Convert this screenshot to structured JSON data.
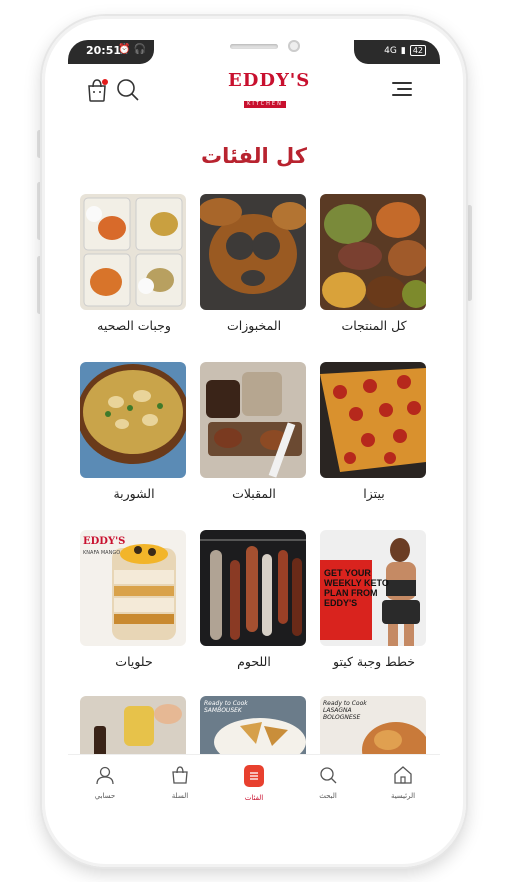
{
  "status_bar": {
    "time": "20:51",
    "left_icons": "⏰ 🎧",
    "network": "4G",
    "battery": "42"
  },
  "brand": {
    "logo_main": "EDDY'S",
    "logo_sub": "KITCHEN"
  },
  "page": {
    "title": "كل الفئات"
  },
  "categories": [
    {
      "label": "كل المنتجات"
    },
    {
      "label": "المخبوزات"
    },
    {
      "label": "وجبات الصحيه"
    },
    {
      "label": "بيتزا"
    },
    {
      "label": "المقبلات"
    },
    {
      "label": "الشوربة"
    },
    {
      "label": "خطط وجبة كيتو"
    },
    {
      "label": "اللحوم"
    },
    {
      "label": "حلويات"
    },
    {
      "label": ""
    },
    {
      "label": ""
    },
    {
      "label": ""
    }
  ],
  "ads": {
    "keto_text": "GET YOUR WEEKLY KETO PLAN FROM EDDY'S",
    "dessert_brand": "EDDY'S",
    "dessert_sub": "KNAFA MANGO",
    "ready_text1": "Ready to Cook SAMBOUSEK",
    "ready_text2": "Ready to Cook LASAGNA BOLOGNESE"
  },
  "tabbar": {
    "home": "الرئيسية",
    "search": "البحث",
    "categories": "الفئات",
    "cart": "السلة",
    "account": "حسابي"
  },
  "colors": {
    "accent": "#c8102e",
    "title": "#b8232f"
  }
}
